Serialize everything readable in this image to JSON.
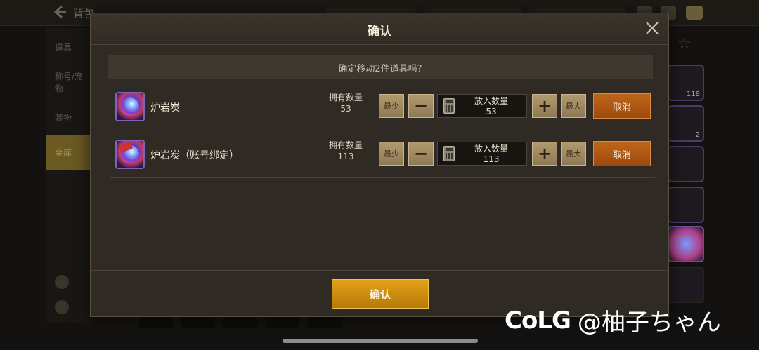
{
  "background": {
    "title": "背包",
    "sidebar_tabs": [
      "道具",
      "称号/宠物",
      "装扮",
      "金库"
    ],
    "active_tab": "金库",
    "right_counts": [
      "118",
      "2"
    ]
  },
  "dialog": {
    "title": "确认",
    "prompt": "确定移动2件道具吗?",
    "rows": [
      {
        "name": "炉岩炭",
        "owned_label": "拥有数量",
        "owned_value": "53",
        "min_label": "最少",
        "put_label": "放入数量",
        "put_value": "53",
        "max_label": "最大",
        "cancel_label": "取消"
      },
      {
        "name": "炉岩炭（账号绑定）",
        "owned_label": "拥有数量",
        "owned_value": "113",
        "min_label": "最少",
        "put_label": "放入数量",
        "put_value": "113",
        "max_label": "最大",
        "cancel_label": "取消"
      }
    ],
    "confirm_label": "确认"
  },
  "watermark": {
    "logo": "CoLG",
    "handle": "@柚子ちゃん"
  },
  "colors": {
    "confirm": "#d4920f",
    "cancel": "#b15a14",
    "gold_button": "#a08b62",
    "item_border": "#7e63b9"
  },
  "icons": [
    "back-arrow-icon",
    "close-icon",
    "calculator-icon",
    "star-icon",
    "chat-icon"
  ]
}
